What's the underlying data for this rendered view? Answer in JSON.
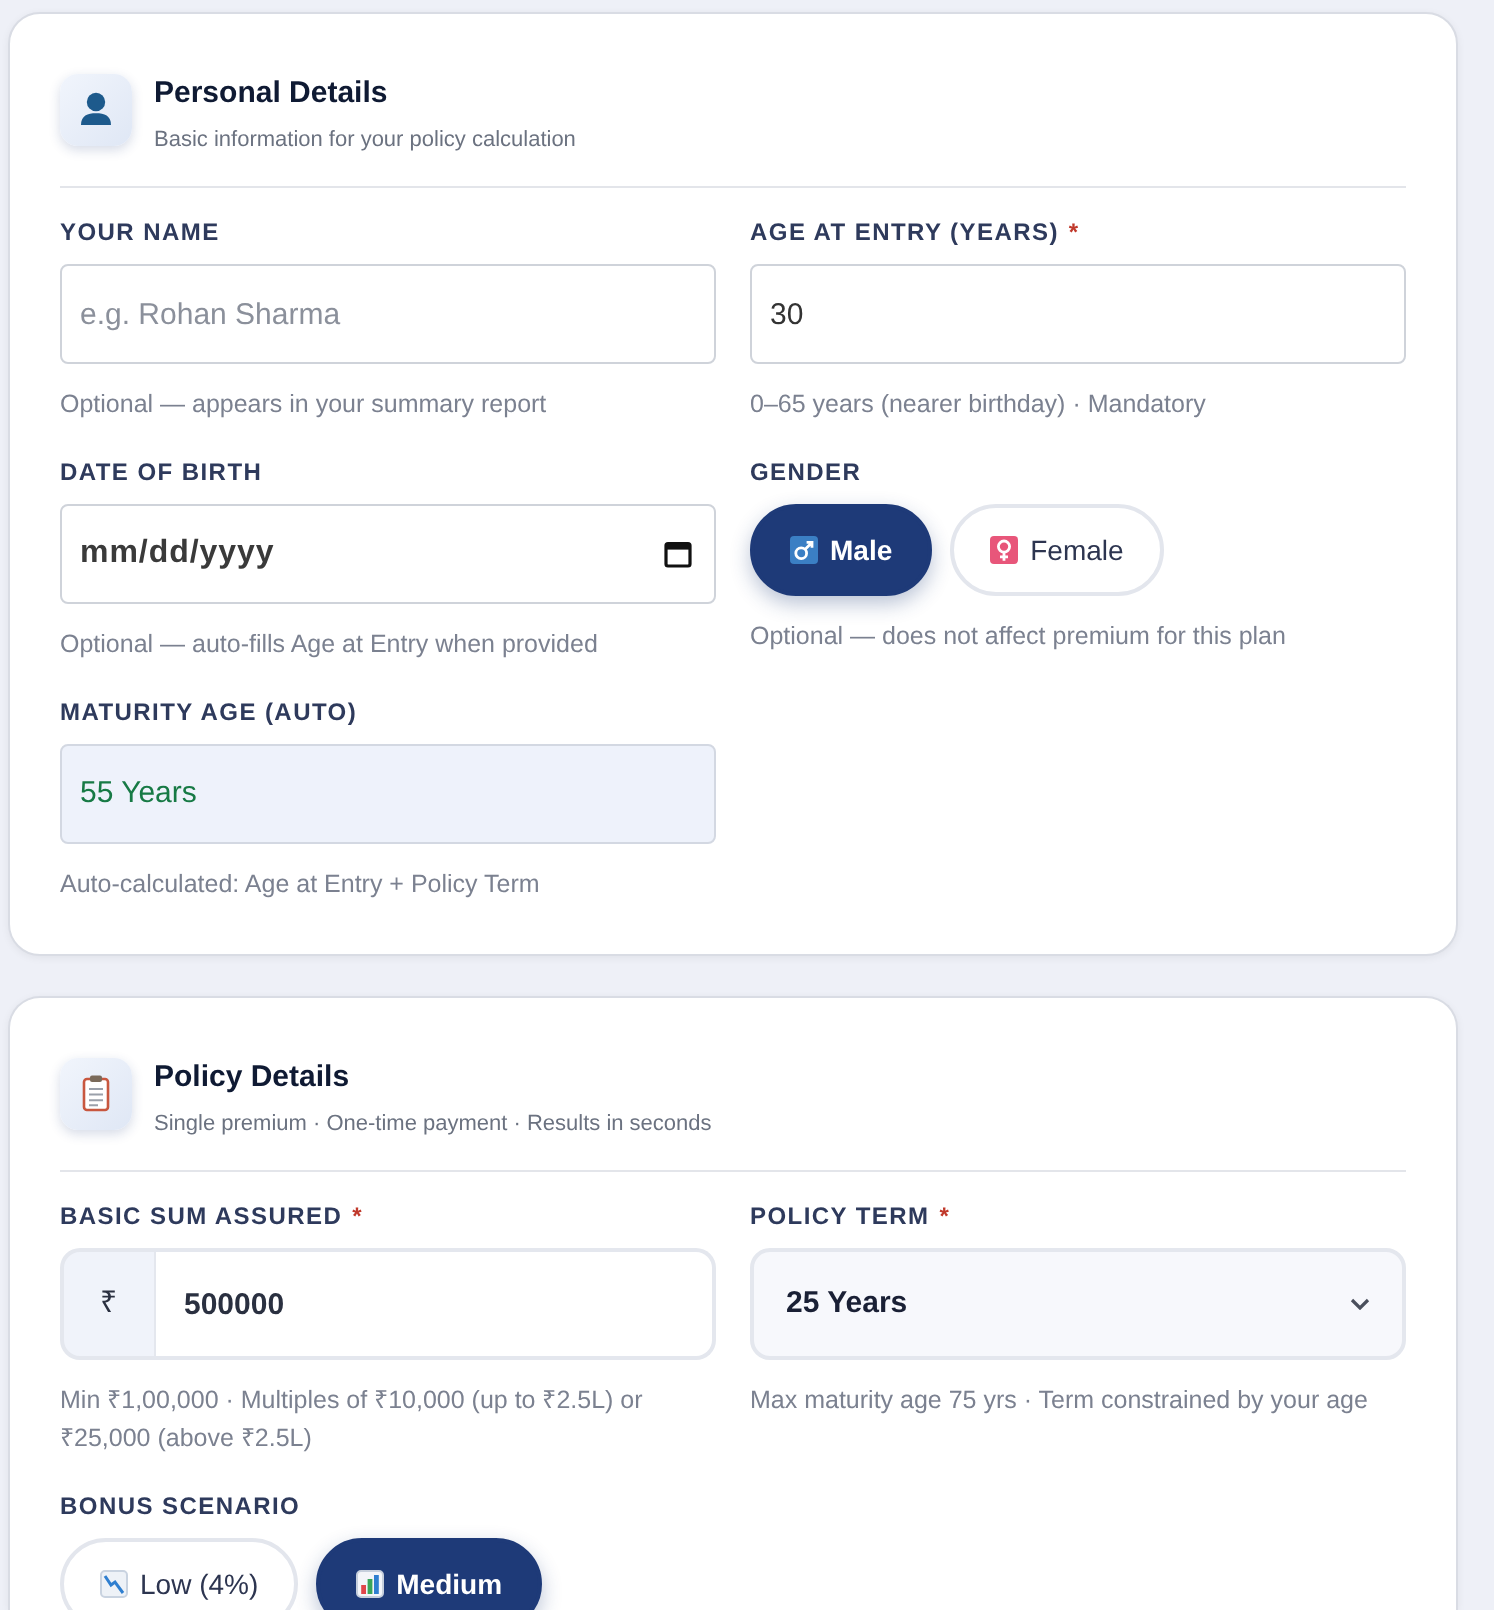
{
  "sections": [
    {
      "title": "Personal Details",
      "subtitle": "Basic information for your policy calculation",
      "fields": [
        {
          "kind": "text",
          "label": "YOUR NAME",
          "placeholder": "e.g. Rohan Sharma",
          "hint": "Optional — appears in your summary report"
        },
        {
          "kind": "text",
          "label": "AGE AT ENTRY (YEARS)",
          "required_mark": "*",
          "value": "30",
          "hint": "0–65 years (nearer birthday) · Mandatory"
        },
        {
          "kind": "date",
          "label": "DATE OF BIRTH",
          "placeholder": "mm/dd/yyyy",
          "hint": "Optional — auto-fills Age at Entry when provided"
        },
        {
          "kind": "choice",
          "label": "GENDER",
          "options": [
            {
              "label": "Male",
              "selected": true
            },
            {
              "label": "Female",
              "selected": false
            }
          ],
          "hint": "Optional — does not affect premium for this plan"
        },
        {
          "kind": "readonly",
          "label": "MATURITY AGE (AUTO)",
          "value": "55 Years",
          "hint": "Auto-calculated: Age at Entry + Policy Term"
        }
      ]
    },
    {
      "title": "Policy Details",
      "subtitle": "Single premium · One-time payment · Results in seconds",
      "fields": [
        {
          "kind": "currency",
          "label": "BASIC SUM ASSURED",
          "required_mark": "*",
          "prefix": "₹",
          "value": "500000",
          "hint": "Min ₹1,00,000 · Multiples of ₹10,000 (up to ₹2.5L) or ₹25,000 (above ₹2.5L)"
        },
        {
          "kind": "select",
          "label": "POLICY TERM",
          "required_mark": "*",
          "value": "25 Years",
          "hint": "Max maturity age 75 yrs · Term constrained by your age"
        },
        {
          "kind": "choice",
          "label": "BONUS SCENARIO",
          "options": [
            {
              "label": "Low (4%)",
              "selected": false
            },
            {
              "label": "Medium",
              "selected": true
            }
          ]
        }
      ]
    }
  ]
}
